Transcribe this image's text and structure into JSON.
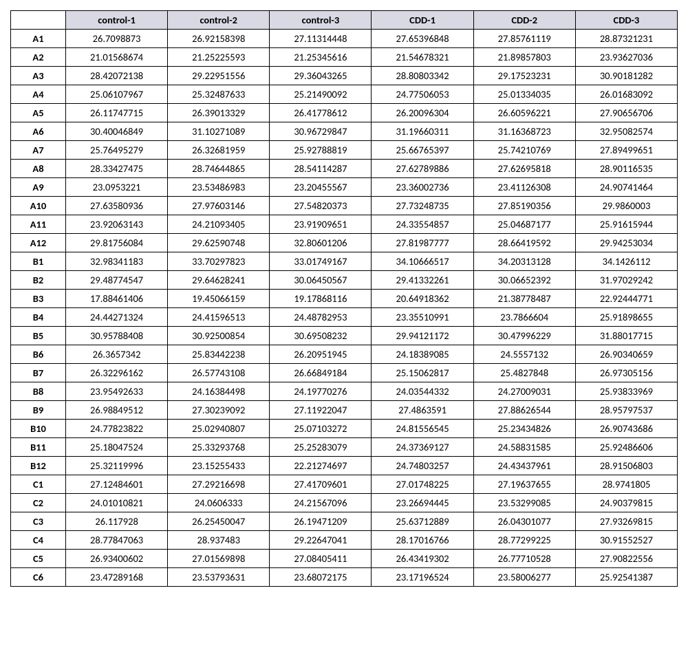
{
  "headers": [
    "control-1",
    "control-2",
    "control-3",
    "CDD-1",
    "CDD-2",
    "CDD-3"
  ],
  "rows": [
    {
      "label": "A1",
      "v": [
        "26.7098873",
        "26.92158398",
        "27.11314448",
        "27.65396848",
        "27.85761119",
        "28.87321231"
      ]
    },
    {
      "label": "A2",
      "v": [
        "21.01568674",
        "21.25225593",
        "21.25345616",
        "21.54678321",
        "21.89857803",
        "23.93627036"
      ]
    },
    {
      "label": "A3",
      "v": [
        "28.42072138",
        "29.22951556",
        "29.36043265",
        "28.80803342",
        "29.17523231",
        "30.90181282"
      ]
    },
    {
      "label": "A4",
      "v": [
        "25.06107967",
        "25.32487633",
        "25.21490092",
        "24.77506053",
        "25.01334035",
        "26.01683092"
      ]
    },
    {
      "label": "A5",
      "v": [
        "26.11747715",
        "26.39013329",
        "26.41778612",
        "26.20096304",
        "26.60596221",
        "27.90656706"
      ]
    },
    {
      "label": "A6",
      "v": [
        "30.40046849",
        "31.10271089",
        "30.96729847",
        "31.19660311",
        "31.16368723",
        "32.95082574"
      ]
    },
    {
      "label": "A7",
      "v": [
        "25.76495279",
        "26.32681959",
        "25.92788819",
        "25.66765397",
        "25.74210769",
        "27.89499651"
      ]
    },
    {
      "label": "A8",
      "v": [
        "28.33427475",
        "28.74644865",
        "28.54114287",
        "27.62789886",
        "27.62695818",
        "28.90116535"
      ]
    },
    {
      "label": "A9",
      "v": [
        "23.0953221",
        "23.53486983",
        "23.20455567",
        "23.36002736",
        "23.41126308",
        "24.90741464"
      ]
    },
    {
      "label": "A10",
      "v": [
        "27.63580936",
        "27.97603146",
        "27.54820373",
        "27.73248735",
        "27.85190356",
        "29.9860003"
      ]
    },
    {
      "label": "A11",
      "v": [
        "23.92063143",
        "24.21093405",
        "23.91909651",
        "24.33554857",
        "25.04687177",
        "25.91615944"
      ]
    },
    {
      "label": "A12",
      "v": [
        "29.81756084",
        "29.62590748",
        "32.80601206",
        "27.81987777",
        "28.66419592",
        "29.94253034"
      ]
    },
    {
      "label": "B1",
      "v": [
        "32.98341183",
        "33.70297823",
        "33.01749167",
        "34.10666517",
        "34.20313128",
        "34.1426112"
      ]
    },
    {
      "label": "B2",
      "v": [
        "29.48774547",
        "29.64628241",
        "30.06450567",
        "29.41332261",
        "30.06652392",
        "31.97029242"
      ]
    },
    {
      "label": "B3",
      "v": [
        "17.88461406",
        "19.45066159",
        "19.17868116",
        "20.64918362",
        "21.38778487",
        "22.92444771"
      ]
    },
    {
      "label": "B4",
      "v": [
        "24.44271324",
        "24.41596513",
        "24.48782953",
        "23.35510991",
        "23.7866604",
        "25.91898655"
      ]
    },
    {
      "label": "B5",
      "v": [
        "30.95788408",
        "30.92500854",
        "30.69508232",
        "29.94121172",
        "30.47996229",
        "31.88017715"
      ]
    },
    {
      "label": "B6",
      "v": [
        "26.3657342",
        "25.83442238",
        "26.20951945",
        "24.18389085",
        "24.5557132",
        "26.90340659"
      ]
    },
    {
      "label": "B7",
      "v": [
        "26.32296162",
        "26.57743108",
        "26.66849184",
        "25.15062817",
        "25.4827848",
        "26.97305156"
      ]
    },
    {
      "label": "B8",
      "v": [
        "23.95492633",
        "24.16384498",
        "24.19770276",
        "24.03544332",
        "24.27009031",
        "25.93833969"
      ]
    },
    {
      "label": "B9",
      "v": [
        "26.98849512",
        "27.30239092",
        "27.11922047",
        "27.4863591",
        "27.88626544",
        "28.95797537"
      ]
    },
    {
      "label": "B10",
      "v": [
        "24.77823822",
        "25.02940807",
        "25.07103272",
        "24.81556545",
        "25.23434826",
        "26.90743686"
      ]
    },
    {
      "label": "B11",
      "v": [
        "25.18047524",
        "25.33293768",
        "25.25283079",
        "24.37369127",
        "24.58831585",
        "25.92486606"
      ]
    },
    {
      "label": "B12",
      "v": [
        "25.32119996",
        "23.15255433",
        "22.21274697",
        "24.74803257",
        "24.43437961",
        "28.91506803"
      ]
    },
    {
      "label": "C1",
      "v": [
        "27.12484601",
        "27.29216698",
        "27.41709601",
        "27.01748225",
        "27.19637655",
        "28.9741805"
      ]
    },
    {
      "label": "C2",
      "v": [
        "24.01010821",
        "24.0606333",
        "24.21567096",
        "23.26694445",
        "23.53299085",
        "24.90379815"
      ]
    },
    {
      "label": "C3",
      "v": [
        "26.117928",
        "26.25450047",
        "26.19471209",
        "25.63712889",
        "26.04301077",
        "27.93269815"
      ]
    },
    {
      "label": "C4",
      "v": [
        "28.77847063",
        "28.937483",
        "29.22647041",
        "28.17016766",
        "28.77299225",
        "30.91552527"
      ]
    },
    {
      "label": "C5",
      "v": [
        "26.93400602",
        "27.01569898",
        "27.08405411",
        "26.43419302",
        "26.77710528",
        "27.90822556"
      ]
    },
    {
      "label": "C6",
      "v": [
        "23.47289168",
        "23.53793631",
        "23.68072175",
        "23.17196524",
        "23.58006277",
        "25.92541387"
      ]
    }
  ]
}
